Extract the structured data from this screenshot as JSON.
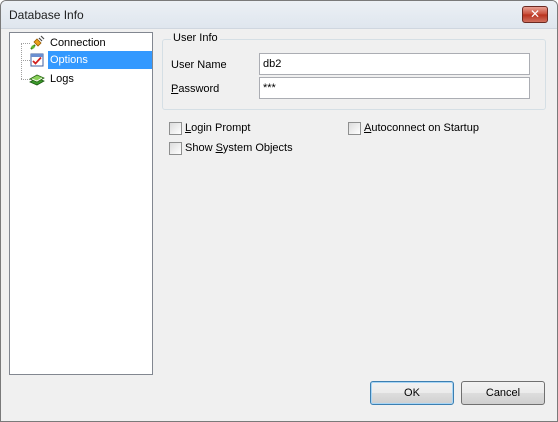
{
  "window": {
    "title": "Database Info",
    "close_glyph": "✕"
  },
  "tree": {
    "items": [
      {
        "label": "Connection",
        "icon": "connection-plug-icon",
        "selected": false
      },
      {
        "label": "Options",
        "icon": "options-checklist-icon",
        "selected": true
      },
      {
        "label": "Logs",
        "icon": "logs-book-icon",
        "selected": false
      }
    ]
  },
  "user_info": {
    "legend": "User Info",
    "user_name_label": "User Name",
    "user_name_value": "db2",
    "password_label_prefix": "",
    "password_label_accel": "P",
    "password_label_rest": "assword",
    "password_value": "***"
  },
  "options": {
    "login_prompt": {
      "accel": "L",
      "rest": "ogin Prompt",
      "checked": false
    },
    "autoconnect": {
      "accel": "A",
      "rest": "utoconnect on Startup",
      "checked": false
    },
    "show_system_objects": {
      "prefix": "Show ",
      "accel": "S",
      "rest": "ystem Objects",
      "checked": false
    }
  },
  "buttons": {
    "ok": "OK",
    "cancel": "Cancel"
  },
  "colors": {
    "selection": "#3399ff",
    "close_button": "#c74a36"
  }
}
